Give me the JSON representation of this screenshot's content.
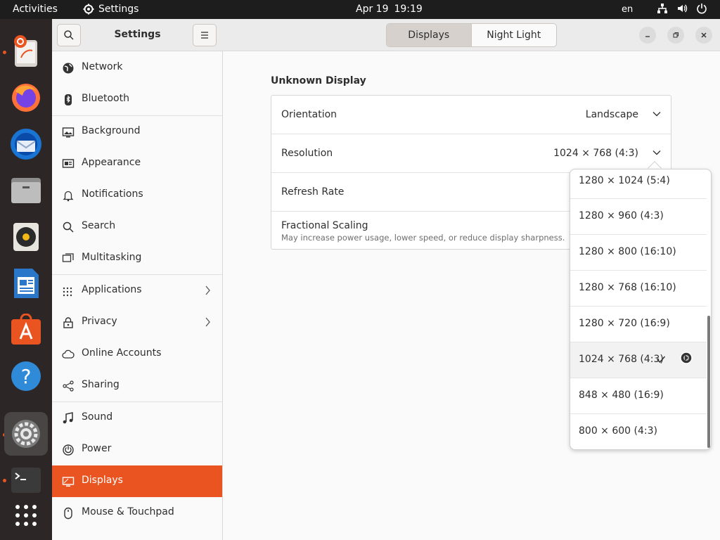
{
  "topbar": {
    "activities": "Activities",
    "app_name": "Settings",
    "date": "Apr 19",
    "time": "19:19",
    "language": "en"
  },
  "dock": {
    "apps": [
      "ubuntu-help-icon",
      "firefox-icon",
      "thunderbird-icon",
      "files-icon",
      "rhythmbox-icon",
      "libreoffice-writer-icon",
      "app-center-icon",
      "help-icon",
      "settings-icon",
      "terminal-icon",
      "show-apps-icon"
    ]
  },
  "sidebar": {
    "title": "Settings",
    "items": [
      {
        "label": "Network",
        "icon": "globe-icon"
      },
      {
        "label": "Bluetooth",
        "icon": "bluetooth-icon"
      },
      {
        "label": "Background",
        "icon": "background-icon"
      },
      {
        "label": "Appearance",
        "icon": "appearance-icon"
      },
      {
        "label": "Notifications",
        "icon": "bell-icon"
      },
      {
        "label": "Search",
        "icon": "search-icon"
      },
      {
        "label": "Multitasking",
        "icon": "multitasking-icon"
      },
      {
        "label": "Applications",
        "icon": "grid-icon"
      },
      {
        "label": "Privacy",
        "icon": "lock-icon"
      },
      {
        "label": "Online Accounts",
        "icon": "cloud-icon"
      },
      {
        "label": "Sharing",
        "icon": "share-icon"
      },
      {
        "label": "Sound",
        "icon": "music-note-icon"
      },
      {
        "label": "Power",
        "icon": "power-icon"
      },
      {
        "label": "Displays",
        "icon": "display-icon"
      },
      {
        "label": "Mouse & Touchpad",
        "icon": "mouse-icon"
      }
    ],
    "selected": "Displays"
  },
  "header": {
    "tabs": [
      "Displays",
      "Night Light"
    ],
    "active_tab": "Displays"
  },
  "main": {
    "section_title": "Unknown Display",
    "rows": {
      "orientation_label": "Orientation",
      "orientation_value": "Landscape",
      "resolution_label": "Resolution",
      "resolution_value": "1024 × 768 (4:3)",
      "refresh_label": "Refresh Rate",
      "scaling_label": "Fractional Scaling",
      "scaling_sub": "May increase power usage, lower speed, or reduce display sharpness."
    }
  },
  "popover": {
    "options": [
      "1280 × 1024 (5:4)",
      "1280 × 960 (4:3)",
      "1280 × 800 (16:10)",
      "1280 × 768 (16:10)",
      "1280 × 720 (16:9)",
      "1024 × 768 (4:3)",
      "848 × 480 (16:9)",
      "800 × 600 (4:3)"
    ],
    "selected": "1024 × 768 (4:3)"
  },
  "colors": {
    "accent": "#e95420",
    "topbar": "#1d1d1d",
    "dock": "#2d2626"
  }
}
